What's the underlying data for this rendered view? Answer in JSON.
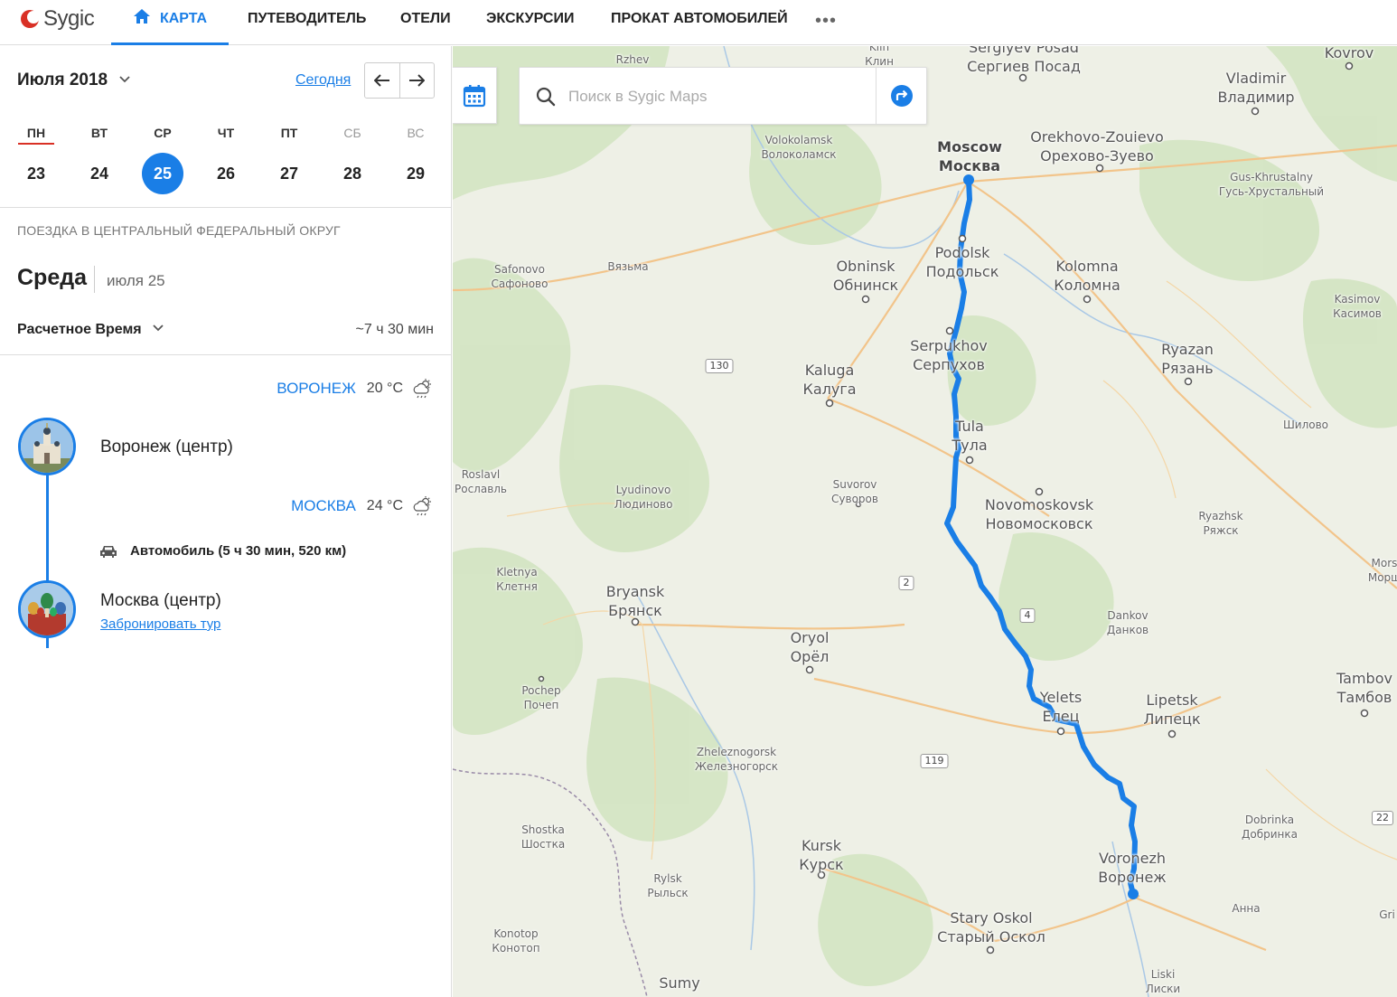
{
  "brand": {
    "name": "Sygic",
    "accent": "#1a7ee6",
    "logo_color": "#d93025"
  },
  "nav": {
    "items": [
      {
        "label": "КАРТА",
        "active": true,
        "icon": "home-icon"
      },
      {
        "label": "ПУТЕВОДИТЕЛЬ"
      },
      {
        "label": "ОТЕЛИ"
      },
      {
        "label": "ЭКСКУРСИИ"
      },
      {
        "label": "ПРОКАТ АВТОМОБИЛЕЙ"
      }
    ],
    "more": "•••"
  },
  "calendar": {
    "month": "Июля 2018",
    "today_label": "Сегодня",
    "weekdays": [
      "ПН",
      "ВТ",
      "СР",
      "ЧТ",
      "ПТ",
      "СБ",
      "ВС"
    ],
    "days": [
      "23",
      "24",
      "25",
      "26",
      "27",
      "28",
      "29"
    ],
    "selected_day": "25"
  },
  "trip": {
    "title": "ПОЕЗДКА В ЦЕНТРАЛЬНЫЙ ФЕДЕРАЛЬНЫЙ ОКРУГ",
    "day_name": "Среда",
    "day_date": "июля 25",
    "calc_time_label": "Расчетное Время",
    "calc_time_value": "~7 ч 30 мин",
    "weather": [
      {
        "city": "ВОРОНЕЖ",
        "temp": "20 °C",
        "icon": "partly-cloudy-rain-icon"
      },
      {
        "city": "МОСКВА",
        "temp": "24 °C",
        "icon": "partly-cloudy-rain-icon"
      }
    ],
    "stops": [
      {
        "name": "Воронеж (центр)"
      },
      {
        "name": "Москва (центр)",
        "link": "Забронировать тур"
      }
    ],
    "transport": "Автомобиль (5 ч 30 мин, 520 км)"
  },
  "search": {
    "placeholder": "Поиск в Sygic Maps"
  },
  "map": {
    "route_color": "#1a7ee6",
    "labels": [
      {
        "en": "Sergiyev Posad",
        "ru": "Сергиев Посад"
      },
      {
        "en": "Kovrov",
        "ru": ""
      },
      {
        "en": "Rzhev",
        "ru": ""
      },
      {
        "en": "Klin",
        "ru": "Клин"
      },
      {
        "en": "Vladimir",
        "ru": "Владимир"
      },
      {
        "en": "Moscow",
        "ru": "Москва"
      },
      {
        "en": "Orekhovo-Zouievo",
        "ru": "Орехово-Зуево"
      },
      {
        "en": "Volokolamsk",
        "ru": "Волоколамск"
      },
      {
        "en": "Gus-Khrustalny",
        "ru": "Гусь-Хрустальный"
      },
      {
        "en": "Podolsk",
        "ru": "Подольск"
      },
      {
        "en": "Obninsk",
        "ru": "Обнинск"
      },
      {
        "en": "Kolomna",
        "ru": "Коломна"
      },
      {
        "en": "Safonovo",
        "ru": "Сафоново"
      },
      {
        "en": "",
        "ru": "Вязьма"
      },
      {
        "en": "Kasimov",
        "ru": "Касимов"
      },
      {
        "en": "Serpukhov",
        "ru": "Серпухов"
      },
      {
        "en": "Ryazan",
        "ru": "Рязань"
      },
      {
        "en": "Kaluga",
        "ru": "Калуга"
      },
      {
        "en": "Tula",
        "ru": "Тула"
      },
      {
        "en": "",
        "ru": "Шилово"
      },
      {
        "en": "Roslavl",
        "ru": "Рославль"
      },
      {
        "en": "Suvorov",
        "ru": "Суворов"
      },
      {
        "en": "Lyudinovo",
        "ru": "Людиново"
      },
      {
        "en": "Novomoskovsk",
        "ru": "Новомосковск"
      },
      {
        "en": "Ryazhsk",
        "ru": "Ряжск"
      },
      {
        "en": "Kletnya",
        "ru": "Клетня"
      },
      {
        "en": "Bryansk",
        "ru": "Брянск"
      },
      {
        "en": "Dankov",
        "ru": "Данков"
      },
      {
        "en": "Oryol",
        "ru": "Орёл"
      },
      {
        "en": "Pochep",
        "ru": "Почеп"
      },
      {
        "en": "Yelets",
        "ru": "Елец"
      },
      {
        "en": "Lipetsk",
        "ru": "Липецк"
      },
      {
        "en": "Tambov",
        "ru": "Тамбов"
      },
      {
        "en": "Zheleznogorsk",
        "ru": "Железногорск"
      },
      {
        "en": "Dobrinka",
        "ru": "Добринка"
      },
      {
        "en": "Shostka",
        "ru": "Шостка"
      },
      {
        "en": "Kursk",
        "ru": "Курск"
      },
      {
        "en": "Voronezh",
        "ru": "Воронеж"
      },
      {
        "en": "Rylsk",
        "ru": "Рыльск"
      },
      {
        "en": "Konotop",
        "ru": "Конотоп"
      },
      {
        "en": "Stary Oskol",
        "ru": "Старый Оскол"
      },
      {
        "en": "",
        "ru": "Анна"
      },
      {
        "en": "Sumy",
        "ru": ""
      },
      {
        "en": "Liski",
        "ru": "Лиски"
      },
      {
        "en": "Mors",
        "ru": "Морш"
      },
      {
        "en": "Gri",
        "ru": ""
      }
    ],
    "shields": [
      "130",
      "2",
      "4",
      "119",
      "22"
    ]
  }
}
